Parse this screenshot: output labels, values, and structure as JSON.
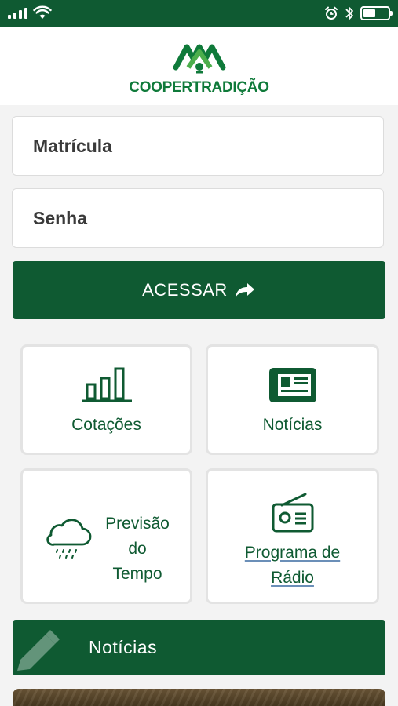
{
  "statusbar": {
    "signal_bars": 4,
    "battery_level": 0.5,
    "icons": [
      "signal-icon",
      "wifi-icon",
      "alarm-icon",
      "bluetooth-icon",
      "battery-icon"
    ]
  },
  "logo": {
    "name": "COOPERTRADIÇÃO",
    "color": "#0f7a3a"
  },
  "login": {
    "username_placeholder": "Matrícula",
    "password_placeholder": "Senha",
    "submit_label": "ACESSAR"
  },
  "tiles": {
    "quotes_label": "Cotações",
    "news_label": "Notícias",
    "weather_label_line1": "Previsão",
    "weather_label_line2": "do",
    "weather_label_line3": "Tempo",
    "radio_label_line1": "Programa de",
    "radio_label_line2": "Rádio"
  },
  "news_section": {
    "title": "Notícias"
  },
  "colors": {
    "brand": "#0f5a32",
    "background": "#f3f3f3",
    "tile_border": "#e3e3e3"
  }
}
